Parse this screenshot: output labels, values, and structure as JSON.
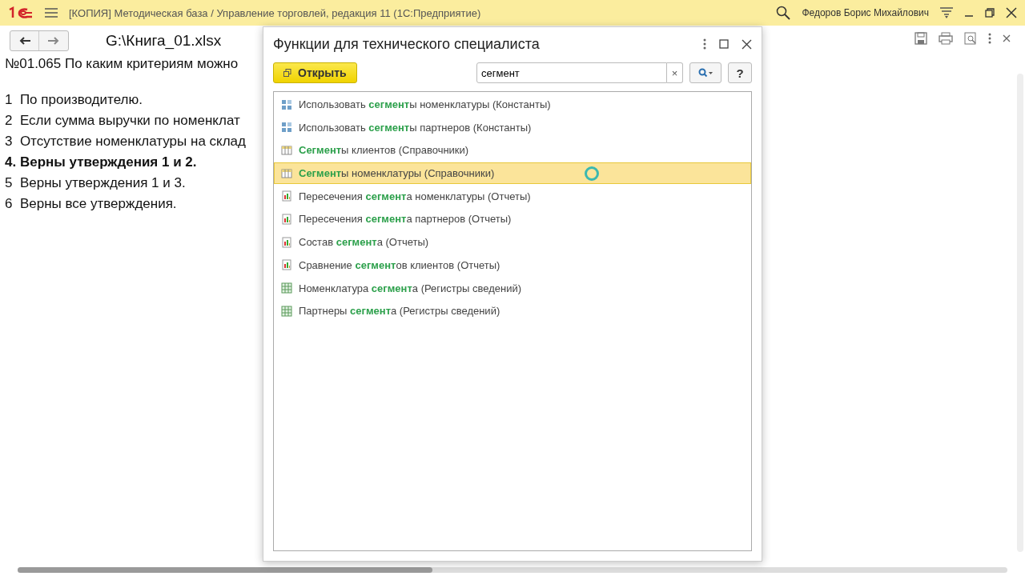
{
  "app_bar": {
    "title": "[КОПИЯ] Методическая база / Управление торговлей, редакция 11  (1С:Предприятие)",
    "user": "Федоров Борис Михайлович"
  },
  "document": {
    "file": "G:\\Книга_01.xlsx",
    "question": "№01.065 По каким критериям можно",
    "lines": [
      {
        "text": "1  По производителю.",
        "bold": false
      },
      {
        "text": "2  Если сумма выручки по номенклат",
        "bold": false
      },
      {
        "text": "3  Отсутствие номенклатуры на склад",
        "bold": false
      },
      {
        "text": "4. Верны утверждения 1 и 2.",
        "bold": true
      },
      {
        "text": "5  Верны утверждения 1 и 3.",
        "bold": false
      },
      {
        "text": "6  Верны все утверждения.",
        "bold": false
      }
    ]
  },
  "dialog": {
    "title": "Функции для технического специалиста",
    "open_button": "Открыть",
    "search": {
      "value": "сегмент"
    },
    "clear": "×",
    "help": "?",
    "items": [
      {
        "kind": "constant",
        "text": "Использовать **сегмент**ы номенклатуры (Константы)",
        "selected": false
      },
      {
        "kind": "constant",
        "text": "Использовать **сегмент**ы партнеров (Константы)",
        "selected": false
      },
      {
        "kind": "catalog",
        "text": "**Сегмент**ы клиентов (Справочники)",
        "selected": false
      },
      {
        "kind": "catalog",
        "text": "**Сегмент**ы номенклатуры (Справочники)",
        "selected": true
      },
      {
        "kind": "report",
        "text": "Пересечения **сегмент**а номенклатуры (Отчеты)",
        "selected": false
      },
      {
        "kind": "report",
        "text": "Пересечения **сегмент**а партнеров (Отчеты)",
        "selected": false
      },
      {
        "kind": "report",
        "text": "Состав **сегмент**а (Отчеты)",
        "selected": false
      },
      {
        "kind": "report",
        "text": "Сравнение **сегмент**ов клиентов (Отчеты)",
        "selected": false
      },
      {
        "kind": "register",
        "text": "Номенклатура **сегмент**а (Регистры сведений)",
        "selected": false
      },
      {
        "kind": "register",
        "text": "Партнеры **сегмент**а (Регистры сведений)",
        "selected": false
      }
    ]
  }
}
